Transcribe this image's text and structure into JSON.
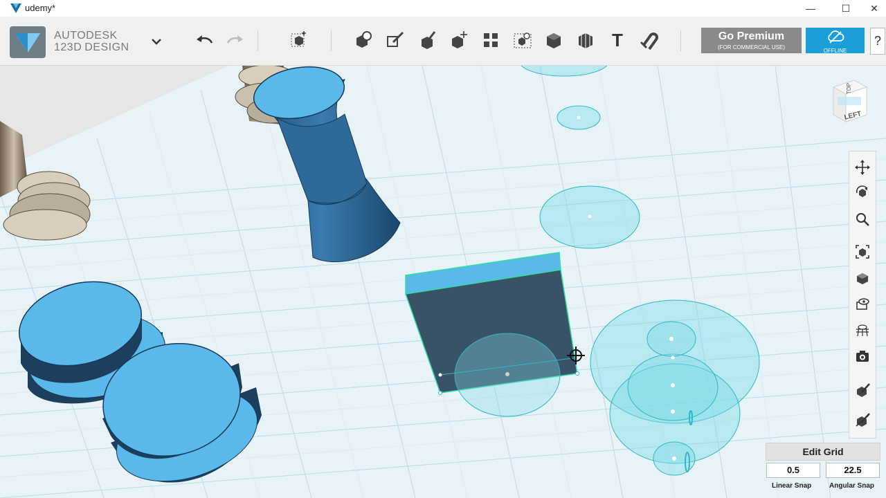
{
  "window": {
    "title": "udemy*",
    "minimize_glyph": "—",
    "maximize_glyph": "☐",
    "close_glyph": "✕"
  },
  "brand": {
    "name": "AUTODESK",
    "product": "123D",
    "product_suffix": "DESIGN"
  },
  "toolbar": {
    "tools": [
      {
        "name": "undo-icon"
      },
      {
        "name": "redo-icon"
      },
      {
        "name": "transform-icon"
      },
      {
        "name": "primitives-icon"
      },
      {
        "name": "sketch-icon"
      },
      {
        "name": "construct-icon"
      },
      {
        "name": "modify-icon"
      },
      {
        "name": "pattern-icon"
      },
      {
        "name": "group-icon"
      },
      {
        "name": "combine-icon"
      },
      {
        "name": "measure-icon"
      },
      {
        "name": "text-icon",
        "label": "T"
      },
      {
        "name": "snap-icon"
      }
    ]
  },
  "premium": {
    "label": "Go Premium",
    "sublabel": "(FOR COMMERCIAL USE)"
  },
  "offline": {
    "label": "OFFLINE"
  },
  "help": {
    "label": "?"
  },
  "viewcube": {
    "top_label": "TOP",
    "left_label": "LEFT"
  },
  "nav": {
    "items": [
      "pan-icon",
      "orbit-icon",
      "zoom-icon",
      "fit-icon",
      "material-icon",
      "visibility-icon",
      "grid-view-icon",
      "camera-icon",
      "appearance-icon",
      "hide-icon"
    ]
  },
  "grid_panel": {
    "edit_grid_label": "Edit Grid",
    "linear_snap_value": "0.5",
    "angular_snap_value": "22.5",
    "linear_snap_label": "Linear Snap",
    "angular_snap_label": "Angular Snap"
  },
  "colors": {
    "accent": "#1a9fd9",
    "premium": "#8a8a8a",
    "grid_bg": "#e8f3f8",
    "grid_line": "#b9dcea",
    "shape_fill": "#5bb8ea",
    "sketch_fill": "#7fdbe6"
  }
}
